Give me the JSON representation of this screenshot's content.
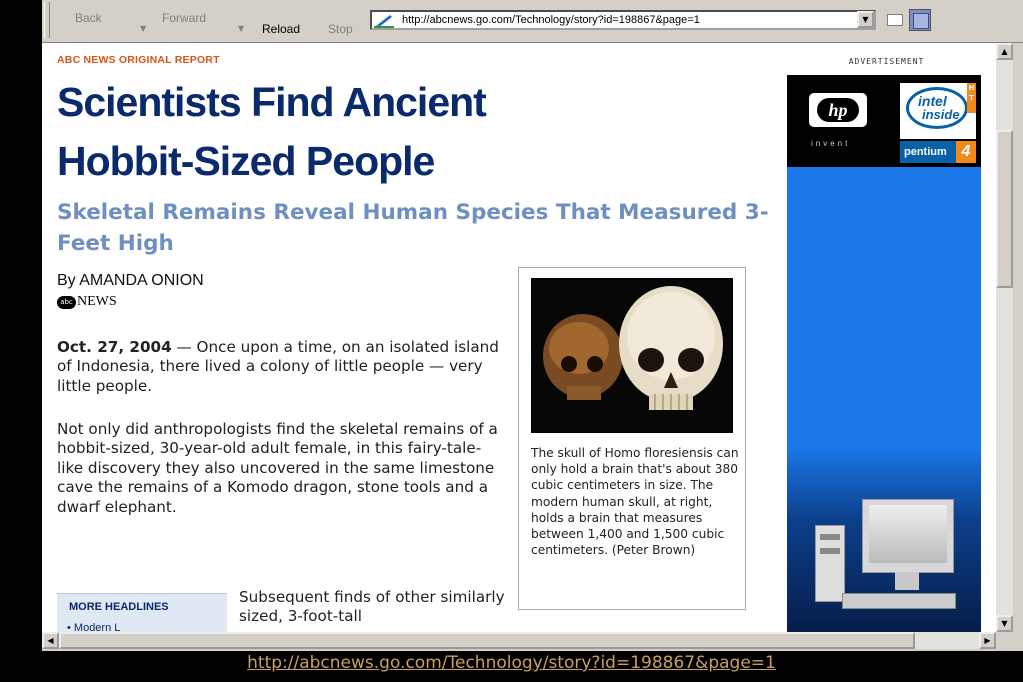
{
  "toolbar": {
    "back_label": "Back",
    "forward_label": "Forward",
    "reload_label": "Reload",
    "stop_label": "Stop",
    "url": "http://abcnews.go.com/Technology/story?id=198867&page=1"
  },
  "article": {
    "kicker": "ABC NEWS ORIGINAL REPORT",
    "headline": "Scientists Find Ancient Hobbit-Sized People",
    "subhead": "Skeletal Remains Reveal Human Species That Measured 3-Feet High",
    "byline": "By AMANDA ONION",
    "source_logo_mark": "abc",
    "source_logo_text": "NEWS",
    "dateline": "Oct. 27, 2004",
    "p1": " — Once upon a time, on an isolated island of Indonesia, there lived a colony of little people — very little people.",
    "p2": "Not only did anthropologists find the skeletal remains of a hobbit-sized, 30-year-old adult female, in this fairy-tale-like discovery they also uncovered in the same limestone cave the remains of a Komodo dragon, stone tools and a dwarf elephant.",
    "p3": "Subsequent finds of other similarly sized, 3-foot-tall"
  },
  "photo": {
    "caption": "The skull of Homo floresiensis can only hold a brain that's about 380 cubic centimeters in size. The modern human skull, at right, holds a brain that measures between 1,400 and 1,500 cubic centimeters. (Peter Brown)"
  },
  "more_headlines": {
    "title": "MORE HEADLINES",
    "first_item": "• Modern L"
  },
  "ad": {
    "label": "ADVERTISEMENT",
    "hp_text": "hp",
    "invent_text": "invent",
    "intel_line1": "intel",
    "intel_line2": "inside",
    "pentium_text": "pentium",
    "pentium_number": "4"
  },
  "footer": {
    "url": "http://abcnews.go.com/Technology/story?id=198867&page=1"
  },
  "colors": {
    "headline": "#0a2a6b",
    "subhead": "#6e8fc0",
    "kicker": "#d5551a",
    "ad_blue": "#1a78e8"
  }
}
